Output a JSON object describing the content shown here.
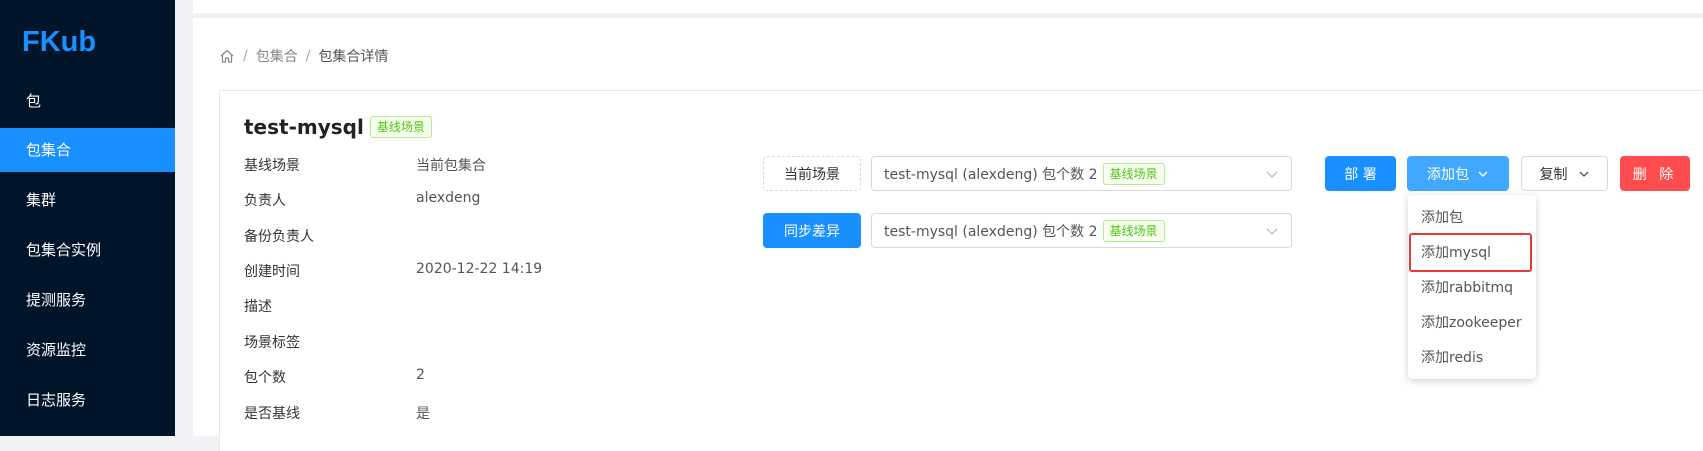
{
  "sidebar": {
    "logo": "FKub",
    "items": [
      {
        "label": "包"
      },
      {
        "label": "包集合",
        "active": true
      },
      {
        "label": "集群"
      },
      {
        "label": "包集合实例"
      },
      {
        "label": "提测服务"
      },
      {
        "label": "资源监控"
      },
      {
        "label": "日志服务"
      }
    ]
  },
  "breadcrumb": {
    "home_icon": "home-icon",
    "items": [
      "包集合",
      "包集合详情"
    ],
    "separator": "/"
  },
  "detail": {
    "name": "test-mysql",
    "tag": "基线场景",
    "fields": [
      {
        "label": "基线场景",
        "value": "当前包集合"
      },
      {
        "label": "负责人",
        "value": "alexdeng"
      },
      {
        "label": "备份负责人",
        "value": ""
      },
      {
        "label": "创建时间",
        "value": "2020-12-22 14:19"
      },
      {
        "label": "描述",
        "value": ""
      },
      {
        "label": "场景标签",
        "value": ""
      },
      {
        "label": "包个数",
        "value": "2"
      },
      {
        "label": "是否基线",
        "value": "是"
      }
    ]
  },
  "scene": {
    "current_button": "当前场景",
    "sync_button": "同步差异",
    "current_select": {
      "text": "test-mysql (alexdeng) 包个数 2",
      "tag": "基线场景"
    },
    "sync_select": {
      "text": "test-mysql (alexdeng) 包个数 2",
      "tag": "基线场景"
    }
  },
  "actions": {
    "deploy": "部 署",
    "add_package": "添加包",
    "copy": "复制",
    "delete": "删 除"
  },
  "add_menu": {
    "items": [
      "添加包",
      "添加mysql",
      "添加rabbitmq",
      "添加zookeeper",
      "添加redis"
    ],
    "highlighted_index": 1
  },
  "colors": {
    "sidebar_bg": "#001529",
    "primary": "#1890ff",
    "danger": "#ff4d4f",
    "success": "#52c41a",
    "highlight_box": "#e53935"
  }
}
